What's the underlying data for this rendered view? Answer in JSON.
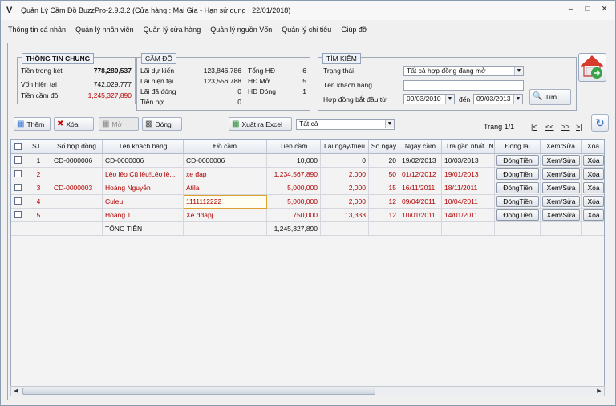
{
  "window": {
    "title": "Quản Lý Cầm Đồ BuzzPro-2.9.3.2 (Cửa hàng : Mai Gia - Hạn sử dụng : 22/01/2018)"
  },
  "menu": [
    "Thông tin cá nhân",
    "Quản lý nhân viên",
    "Quản lý cửa hàng",
    "Quản lý nguồn Vốn",
    "Quản lý chi tiêu",
    "Giúp đỡ"
  ],
  "general": {
    "title": "THÔNG TIN CHUNG",
    "rows": [
      {
        "label": "Tiền trong két",
        "value": "778,280,537"
      },
      {
        "label": "Vốn hiện tại",
        "value": "742,029,777"
      },
      {
        "label": "Tiền cầm đồ",
        "value": "1,245,327,890"
      }
    ]
  },
  "pawn": {
    "title": "CẦM ĐỒ",
    "rows": [
      {
        "label": "Lãi dự kiến",
        "value": "123,846,786"
      },
      {
        "label": "Lãi hiện tại",
        "value": "123,556,788"
      },
      {
        "label": "Lãi đã đóng",
        "value": "0"
      },
      {
        "label": "Tiền nợ",
        "value": "0"
      }
    ],
    "counts": [
      {
        "label": "Tổng HĐ",
        "value": "6"
      },
      {
        "label": "HĐ Mở",
        "value": "5"
      },
      {
        "label": "HĐ Đóng",
        "value": "1"
      }
    ]
  },
  "search": {
    "title": "TÌM KIẾM",
    "status_label": "Trạng thái",
    "status_value": "Tất cả hợp đồng đang mở",
    "customer_label": "Tên khách hàng",
    "customer_value": "",
    "date_label": "Hợp đồng bắt đầu từ",
    "date_from": "09/03/2010",
    "to_label": "đến",
    "date_to": "09/03/2013",
    "find_label": "Tìm"
  },
  "toolbar": {
    "add": "Thêm",
    "delete": "Xóa",
    "open": "Mở",
    "close": "Đóng",
    "export": "Xuất ra Excel",
    "filter": "Tất cả"
  },
  "pager": {
    "page_text": "Trang 1/1",
    "first": "|<",
    "prev": "<<",
    "next": ">>",
    "last": ">|"
  },
  "table": {
    "headers": [
      "STT",
      "Số hợp đồng",
      "Tên khách hàng",
      "Đồ cầm",
      "Tiền cầm",
      "Lãi ngày/triệu",
      "Số ngày",
      "Ngày cầm",
      "Trả gần nhất",
      "N",
      "Đóng lãi",
      "Xem/Sửa",
      "Xóa"
    ],
    "rows": [
      {
        "stt": "1",
        "contract": "CD-0000006",
        "customer": "CD-0000006",
        "item": "CD-0000006",
        "amount": "10,000",
        "rate": "0",
        "days": "20",
        "date": "19/02/2013",
        "last": "10/03/2013",
        "color": "#111111"
      },
      {
        "stt": "2",
        "contract": "",
        "customer": "Lêo lêo Cũ lêu!Lêo lê...",
        "item": "xe đạp",
        "amount": "1,234,567,890",
        "rate": "2,000",
        "days": "50",
        "date": "01/12/2012",
        "last": "19/01/2013",
        "color": "#b00000"
      },
      {
        "stt": "3",
        "contract": "CD-0000003",
        "customer": "Hoàng Nguyễn",
        "item": "Atila",
        "amount": "5,000,000",
        "rate": "2,000",
        "days": "15",
        "date": "16/11/2011",
        "last": "18/11/2011",
        "color": "#b00000"
      },
      {
        "stt": "4",
        "contract": "",
        "customer": "Culeu",
        "item": "1111112222",
        "amount": "5,000,000",
        "rate": "2,000",
        "days": "12",
        "date": "09/04/2011",
        "last": "10/04/2011",
        "color": "#b00000"
      },
      {
        "stt": "5",
        "contract": "",
        "customer": "Hoang 1",
        "item": "Xe ddapj",
        "amount": "750,000",
        "rate": "13,333",
        "days": "12",
        "date": "10/01/2011",
        "last": "14/01/2011",
        "color": "#b00000"
      }
    ],
    "action_pay": "ĐóngTiền",
    "action_edit": "Xem/Sửa",
    "action_delete": "Xóa",
    "total_label": "TỔNG TIỀN",
    "total_value": "1,245,327,890"
  }
}
